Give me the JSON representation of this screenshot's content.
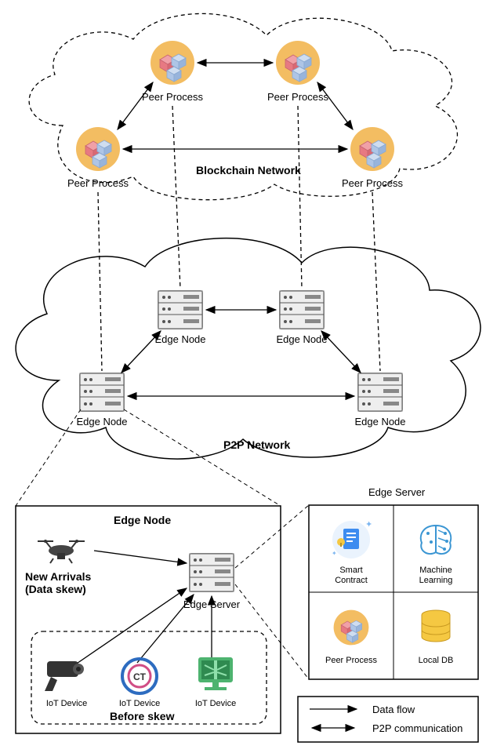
{
  "layers": {
    "blockchain": {
      "title": "Blockchain Network",
      "nodes": [
        "Peer Process",
        "Peer Process",
        "Peer Process",
        "Peer Process"
      ]
    },
    "p2p": {
      "title": "P2P Network",
      "nodes": [
        "Edge Node",
        "Edge Node",
        "Edge Node",
        "Edge Node"
      ]
    }
  },
  "edge_node_detail": {
    "title": "Edge Node",
    "server_label": "Edge Server",
    "new_arrivals_l1": "New Arrivals",
    "new_arrivals_l2": "(Data skew)",
    "before_skew": "Before skew",
    "iot": [
      "IoT Device",
      "IoT Device",
      "IoT Device"
    ]
  },
  "edge_server_detail": {
    "title": "Edge Server",
    "items": {
      "smart_contract_l1": "Smart",
      "smart_contract_l2": "Contract",
      "ml_l1": "Machine",
      "ml_l2": "Learning",
      "peer": "Peer Process",
      "db": "Local DB"
    }
  },
  "legend": {
    "flow": "Data flow",
    "p2p": "P2P communication"
  },
  "colors": {
    "peer_circle": "#f3bd62",
    "cube_pink": "#e77982",
    "cube_blue": "#aec5e6",
    "contract_blue": "#3d8cf0",
    "brain_blue": "#3b96d3",
    "db_yellow": "#f5c842",
    "medical_green": "#4db36f"
  }
}
